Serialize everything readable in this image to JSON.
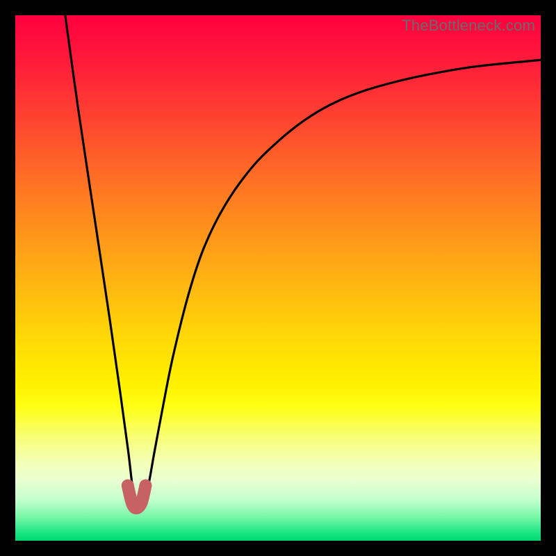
{
  "watermark": "TheBottleneck.com",
  "chart_data": {
    "type": "line",
    "title": "",
    "xlabel": "",
    "ylabel": "",
    "xlim": [
      0,
      100
    ],
    "ylim": [
      0,
      100
    ],
    "grid": false,
    "legend": false,
    "series": [
      {
        "name": "bottleneck-curve",
        "x": [
          9.5,
          12,
          15,
          18,
          20,
          21.5,
          22.5,
          23.6,
          25,
          26.5,
          28,
          30,
          33,
          36,
          40,
          45,
          50,
          55,
          60,
          66,
          73,
          80,
          88,
          100
        ],
        "y": [
          100,
          82,
          62,
          42,
          28,
          17,
          9,
          6,
          9,
          17,
          25,
          35,
          47,
          56,
          64,
          71,
          76,
          80,
          83,
          85.5,
          87.5,
          89,
          90.3,
          91.5
        ]
      }
    ],
    "highlight_segment": {
      "name": "optimal-range",
      "color": "#c66164",
      "x": [
        21.4,
        22.2,
        23.0,
        24.0,
        24.8
      ],
      "y": [
        10.5,
        7.2,
        6.2,
        7.2,
        10.5
      ]
    },
    "gradient_stops": [
      {
        "offset": 0.0,
        "color": "#ff003f"
      },
      {
        "offset": 0.09,
        "color": "#ff1c3a"
      },
      {
        "offset": 0.2,
        "color": "#ff4430"
      },
      {
        "offset": 0.34,
        "color": "#ff7a22"
      },
      {
        "offset": 0.48,
        "color": "#ffab15"
      },
      {
        "offset": 0.6,
        "color": "#ffd408"
      },
      {
        "offset": 0.7,
        "color": "#fff100"
      },
      {
        "offset": 0.745,
        "color": "#ffff15"
      },
      {
        "offset": 0.78,
        "color": "#fbff50"
      },
      {
        "offset": 0.815,
        "color": "#f6ff88"
      },
      {
        "offset": 0.85,
        "color": "#f3ffb4"
      },
      {
        "offset": 0.885,
        "color": "#eaffd1"
      },
      {
        "offset": 0.92,
        "color": "#c6ffcf"
      },
      {
        "offset": 0.955,
        "color": "#78f7a8"
      },
      {
        "offset": 0.985,
        "color": "#19e581"
      },
      {
        "offset": 1.0,
        "color": "#00d873"
      }
    ]
  }
}
